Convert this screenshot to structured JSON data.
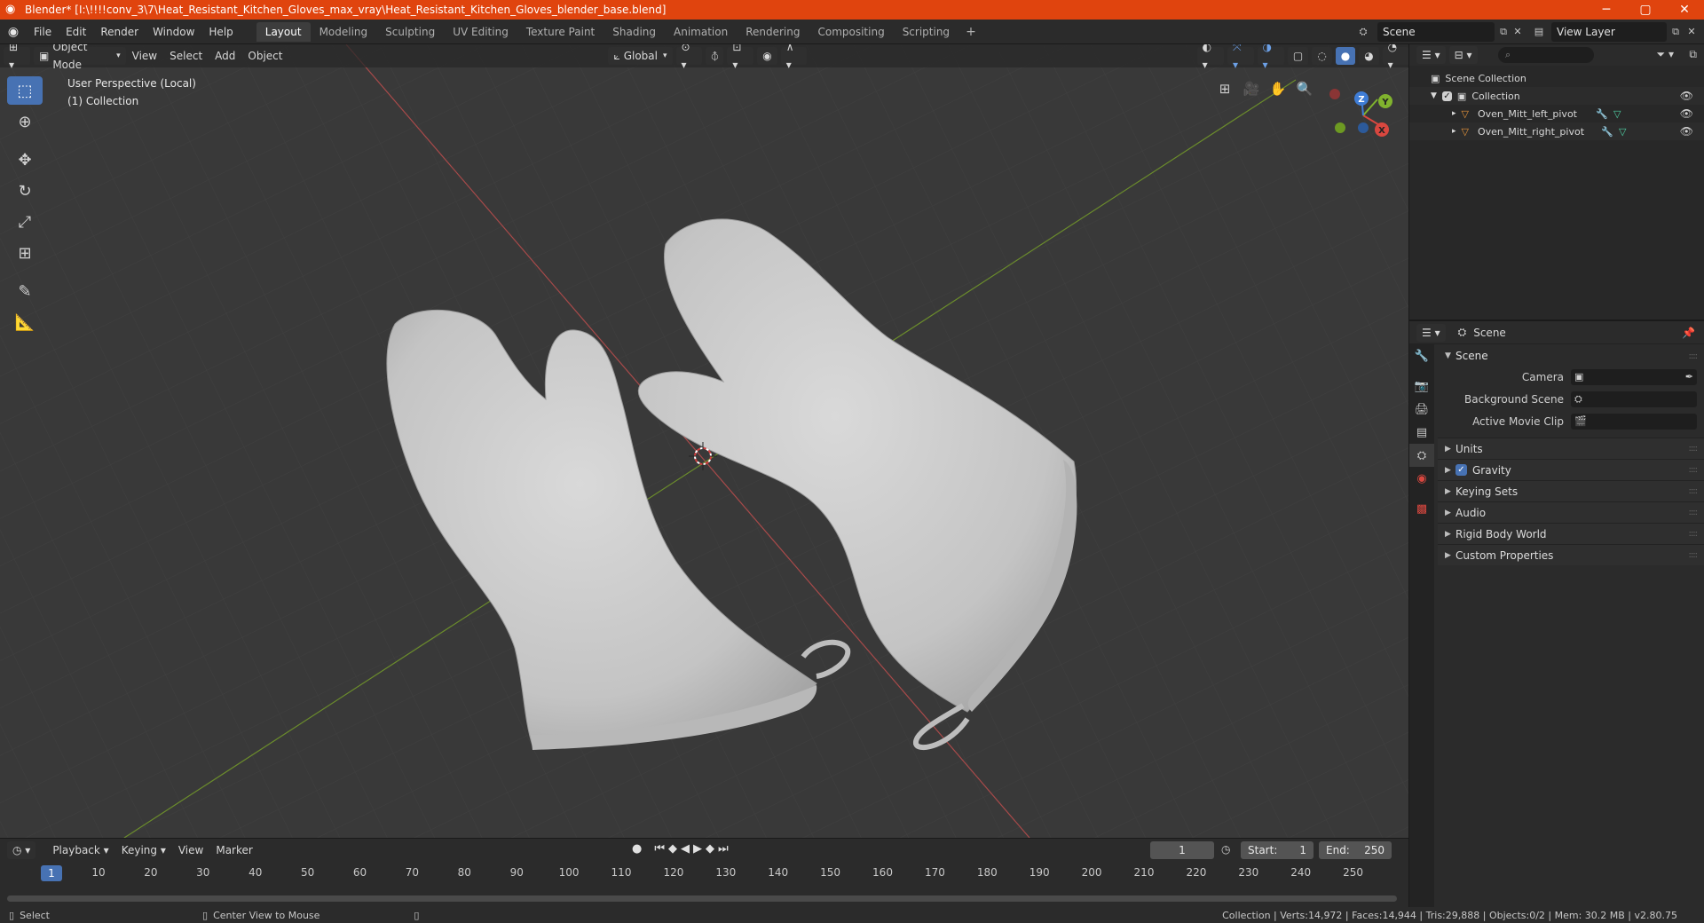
{
  "window": {
    "title": "Blender* [I:\\!!!!conv_3\\7\\Heat_Resistant_Kitchen_Gloves_max_vray\\Heat_Resistant_Kitchen_Gloves_blender_base.blend]",
    "minimize": "─",
    "maximize": "▢",
    "close": "✕"
  },
  "menubar": {
    "items": [
      "File",
      "Edit",
      "Render",
      "Window",
      "Help"
    ]
  },
  "workspaces": {
    "tabs": [
      "Layout",
      "Modeling",
      "Sculpting",
      "UV Editing",
      "Texture Paint",
      "Shading",
      "Animation",
      "Rendering",
      "Compositing",
      "Scripting"
    ],
    "active": "Layout",
    "add": "+"
  },
  "scene_selector": {
    "value": "Scene"
  },
  "view_layer_selector": {
    "value": "View Layer"
  },
  "viewport": {
    "mode": "Object Mode",
    "menus": [
      "View",
      "Select",
      "Add",
      "Object"
    ],
    "transform_orientation": "Global",
    "info_line1": "User Perspective (Local)",
    "info_line2": "(1) Collection",
    "gizmo_axes": {
      "x": "X",
      "y": "Y",
      "z": "Z"
    }
  },
  "outliner": {
    "search_placeholder": "",
    "scene_collection": "Scene Collection",
    "collection": "Collection",
    "objects": [
      "Oven_Mitt_left_pivot",
      "Oven_Mitt_right_pivot"
    ]
  },
  "properties": {
    "header_context": "Scene",
    "panel_title": "Scene",
    "camera_label": "Camera",
    "background_scene_label": "Background Scene",
    "active_movie_clip_label": "Active Movie Clip",
    "subpanels": [
      "Units",
      "Gravity",
      "Keying Sets",
      "Audio",
      "Rigid Body World",
      "Custom Properties"
    ],
    "gravity_checked": true
  },
  "timeline": {
    "menus": [
      "Playback",
      "Keying",
      "View",
      "Marker"
    ],
    "current_frame": "1",
    "start_label": "Start:",
    "start_value": "1",
    "end_label": "End:",
    "end_value": "250",
    "ruler": [
      "10",
      "20",
      "30",
      "40",
      "50",
      "60",
      "70",
      "80",
      "90",
      "100",
      "110",
      "120",
      "130",
      "140",
      "150",
      "160",
      "170",
      "180",
      "190",
      "200",
      "210",
      "220",
      "230",
      "240",
      "250"
    ],
    "ruler_current": "1"
  },
  "statusbar": {
    "left_action": "Select",
    "middle_action": "Center View to Mouse",
    "stats": "Collection | Verts:14,972 | Faces:14,944 | Tris:29,888 | Objects:0/2 | Mem: 30.2 MB | v2.80.75"
  },
  "colors": {
    "title_bar": "#e0440e",
    "accent": "#4772b3",
    "viewport_bg": "#393939",
    "x_axis": "#d8473f",
    "y_axis": "#80b32e",
    "z_axis": "#3f7dd6"
  }
}
